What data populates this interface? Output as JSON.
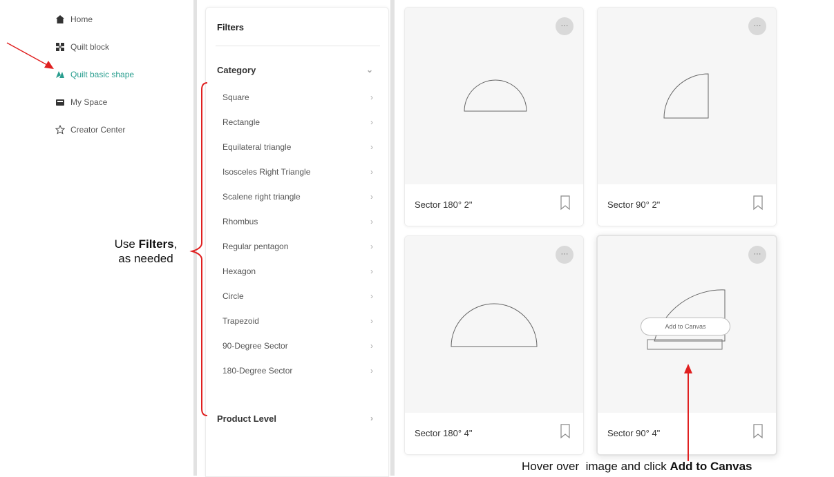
{
  "nav": {
    "items": [
      {
        "label": "Home",
        "icon": "home-icon"
      },
      {
        "label": "Quilt block",
        "icon": "quilt-block-icon"
      },
      {
        "label": "Quilt basic shape",
        "icon": "shape-icon"
      },
      {
        "label": "My Space",
        "icon": "folder-icon"
      },
      {
        "label": "Creator Center",
        "icon": "star-icon"
      }
    ]
  },
  "filters": {
    "title": "Filters",
    "category_label": "Category",
    "categories": [
      "Square",
      "Rectangle",
      "Equilateral triangle",
      "Isosceles Right Triangle",
      "Scalene right triangle",
      "Rhombus",
      "Regular pentagon",
      "Hexagon",
      "Circle",
      "Trapezoid",
      "90-Degree Sector",
      "180-Degree Sector"
    ],
    "product_level_label": "Product Level"
  },
  "cards": [
    {
      "name": "Sector 180° 2\"",
      "more": "···"
    },
    {
      "name": "Sector 90° 2\"",
      "more": "···"
    },
    {
      "name": "Sector 180° 4\"",
      "more": "···"
    },
    {
      "name": "Sector 90° 4\"",
      "more": "···",
      "hover_button": "Add to Canvas"
    }
  ],
  "annotations": {
    "filters_note_bold": "Filters",
    "filters_note_pre": "Use ",
    "filters_note_post": ",",
    "filters_note_line2": "as needed",
    "canvas_note_pre": "Hover over  image and click ",
    "canvas_note_bold": "Add to Canvas"
  },
  "colors": {
    "accent": "#2a9e8f",
    "annotation_red": "#e02020"
  }
}
